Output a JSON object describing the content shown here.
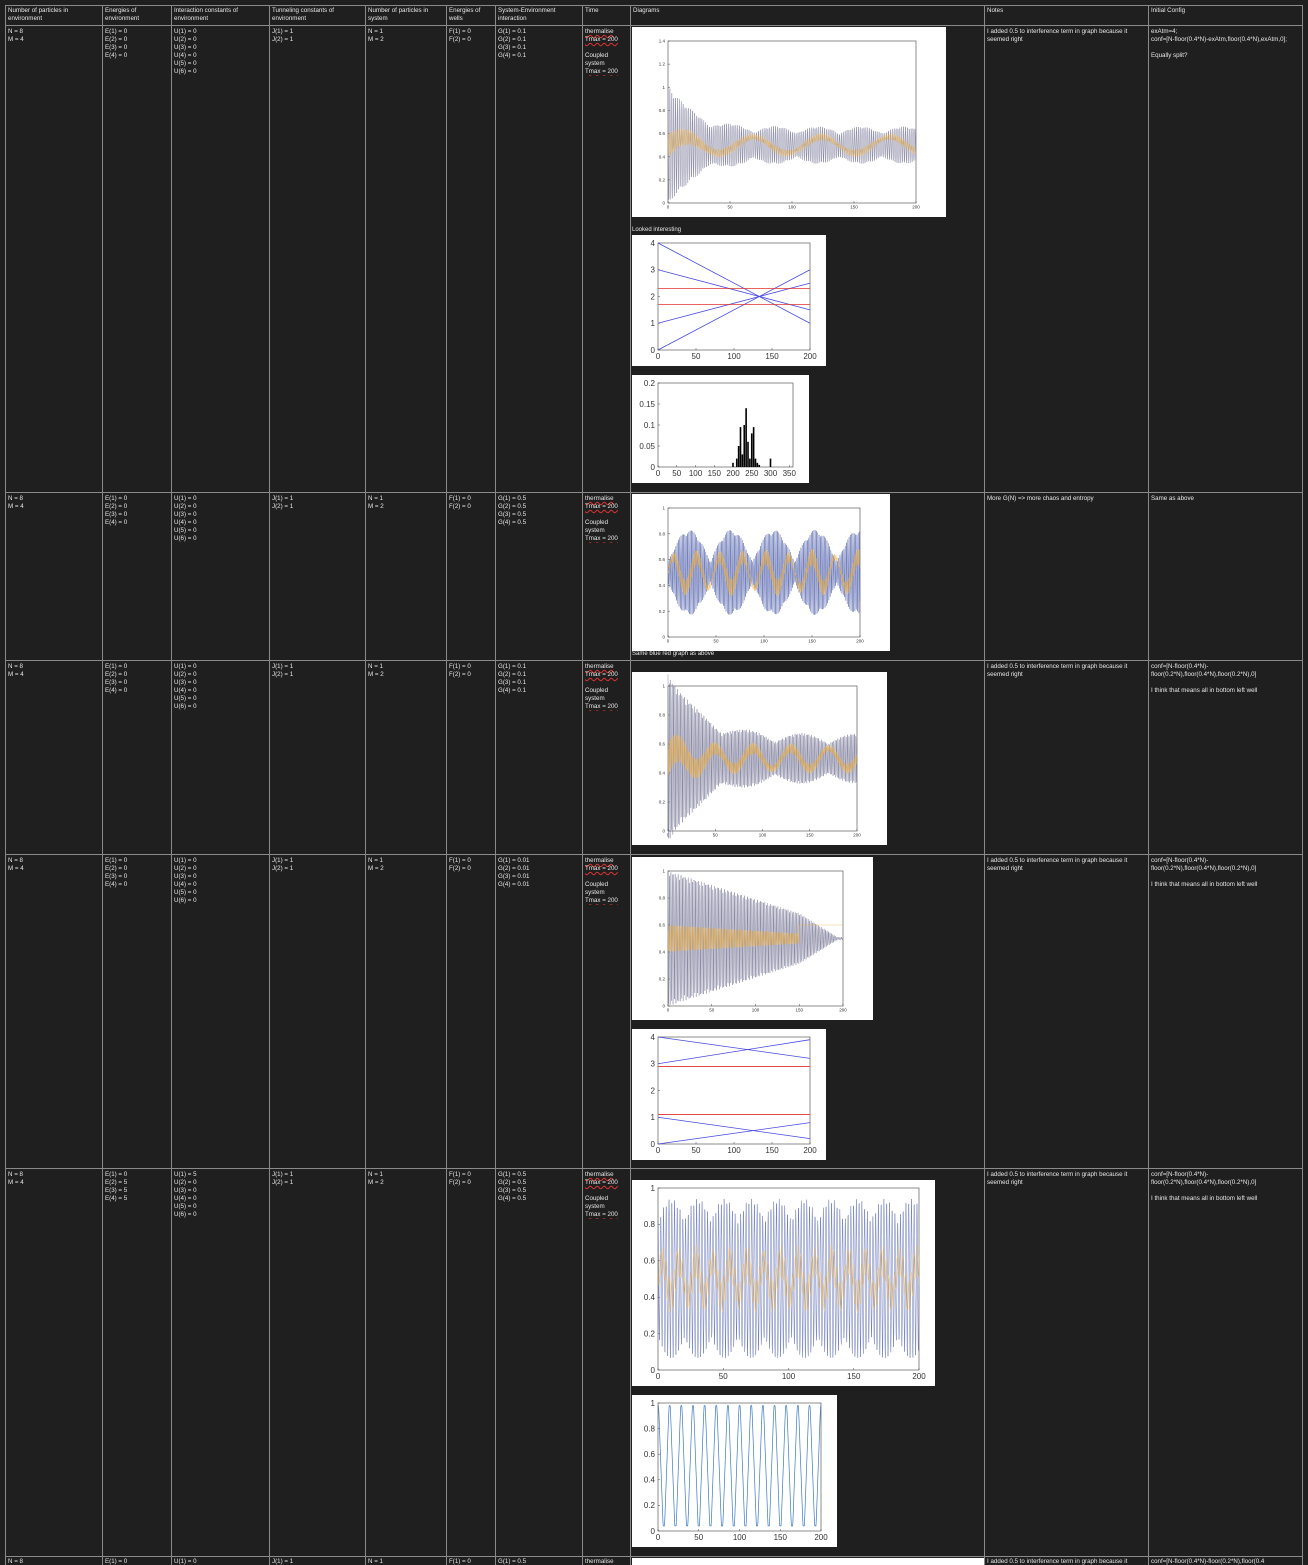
{
  "headers": [
    "Number of  particles in environment",
    "Energies of environment",
    "Interaction constants of environment",
    "Tunneling constants of environment",
    "Number of particles in system",
    "Energies of wells",
    "System-Environment interaction",
    "Time",
    "Diagrams",
    "Notes",
    "Initial Config"
  ],
  "rows": [
    {
      "n_env": "N = 8\nM = 4",
      "e_env": "E(1) = 0\nE(2) = 0\nE(3) = 0\nE(4) = 0",
      "u_env": "U(1) = 0\nU(2) = 0\nU(3) = 0\nU(4) = 0\nU(5) = 0\nU(6) = 0",
      "j_env": "J(1) = 1\nJ(2) = 1",
      "n_sys": "N = 1\nM = 2",
      "f_wells": "F(1) = 0\nF(2) = 0",
      "g_int": "G(1) = 0.1\nG(2) = 0.1\nG(3) = 0.1\nG(4) = 0.1",
      "time_a": "thermalise",
      "time_b": "Tmax = 200",
      "time_c": "Coupled\nsystem",
      "time_d": "Tmax = 200",
      "caption": "Looked interesting",
      "notes": "I added 0.5 to interference term in graph because it seemed right",
      "config": "exAtm=4;\nconf=[N-floor(0.4*N)-exAtm,floor(0.4*N),exAtm,0];\n\nEqually split?"
    },
    {
      "n_env": "N = 8\nM = 4",
      "e_env": "E(1) = 0\nE(2) = 0\nE(3) = 0\nE(4) = 0",
      "u_env": "U(1) = 0\nU(2) = 0\nU(3) = 0\nU(4) = 0\nU(5) = 0\nU(6) = 0",
      "j_env": "J(1) = 1\nJ(2) = 1",
      "n_sys": "N = 1\nM = 2",
      "f_wells": "F(1) = 0\nF(2) = 0",
      "g_int": "G(1) = 0.5\nG(2) = 0.5\nG(3) = 0.5\nG(4) = 0.5",
      "time_a": "thermalise",
      "time_b": "Tmax = 200",
      "time_c": "Coupled\nsystem",
      "time_d": "Tmax = 200",
      "caption": "Same blue red graph as above",
      "notes": "More G(N) => more chaos and entropy",
      "config": "Same as above"
    },
    {
      "n_env": "N = 8\nM = 4",
      "e_env": "E(1) = 0\nE(2) = 0\nE(3) = 0\nE(4) = 0",
      "u_env": "U(1) = 0\nU(2) = 0\nU(3) = 0\nU(4) = 0\nU(5) = 0\nU(6) = 0",
      "j_env": "J(1) = 1\nJ(2) = 1",
      "n_sys": "N = 1\nM = 2",
      "f_wells": "F(1) = 0\nF(2) = 0",
      "g_int": "G(1) = 0.1\nG(2) = 0.1\nG(3) = 0.1\nG(4) = 0.1",
      "time_a": "thermalise",
      "time_b": "Tmax = 200",
      "time_c": "Coupled\nsystem",
      "time_d": "Tmax = 200",
      "notes": "I added 0.5 to interference term in graph because it seemed right",
      "config": "conf=[N-floor(0.4*N)-floor(0.2*N),floor(0.4*N),floor(0.2*N),0]\n\nI think that means all in bottom left well"
    },
    {
      "n_env": "N = 8\nM = 4",
      "e_env": "E(1) = 0\nE(2) = 0\nE(3) = 0\nE(4) = 0",
      "u_env": "U(1) = 0\nU(2) = 0\nU(3) = 0\nU(4) = 0\nU(5) = 0\nU(6) = 0",
      "j_env": "J(1) = 1\nJ(2) = 1",
      "n_sys": "N = 1\nM = 2",
      "f_wells": "F(1) = 0\nF(2) = 0",
      "g_int": "G(1) = 0.01\nG(2) = 0.01\nG(3) = 0.01\nG(4) = 0.01",
      "time_a": "thermalise",
      "time_b": "Tmax = 200",
      "time_c": "Coupled\nsystem",
      "time_d": "Tmax = 200",
      "notes": "I added 0.5 to interference term in graph because it seemed right",
      "config": "conf=[N-floor(0.4*N)-floor(0.2*N),floor(0.4*N),floor(0.2*N),0]\n\nI think that means all in bottom left well"
    },
    {
      "n_env": "N = 8\nM = 4",
      "e_env": "E(1) = 0\nE(2) = 5\nE(3) = 5\nE(4) = 5",
      "u_env": "U(1) = 5\nU(2) = 0\nU(3) = 0\nU(4) = 0\nU(5) = 0\nU(6) = 0",
      "j_env": "J(1) = 1\nJ(2) = 1",
      "n_sys": "N = 1\nM = 2",
      "f_wells": "F(1) = 0\nF(2) = 0",
      "g_int": "G(1) = 0.5\nG(2) = 0.5\nG(3) = 0.5\nG(4) = 0.5",
      "time_a": "thermalise",
      "time_b": "Tmax = 200",
      "time_c": "Coupled\nsystem",
      "time_d": "Tmax = 200",
      "notes": "I added 0.5 to interference term in graph because it seemed right",
      "config": "conf=[N-floor(0.4*N)-floor(0.2*N),floor(0.4*N),floor(0.2*N),0]\n\nI think that means all in bottom left well"
    },
    {
      "n_env": "N = 8",
      "e_env": "E(1) = 0",
      "u_env": "U(1) = 0",
      "j_env": "J(1) = 1",
      "n_sys": "N = 1",
      "f_wells": "F(1) = 0",
      "g_int": "G(1) = 0.5",
      "time_a": "thermalise",
      "notes": "I added 0.5 to interference term in graph because it",
      "config": "conf=[N-floor(0.4*N)-floor(0.2*N),floor(0.4"
    }
  ],
  "chart_data": [
    {
      "id": "p1",
      "type": "line",
      "x_ticks": [
        0,
        50,
        100,
        150,
        200
      ],
      "y_ticks": [
        0,
        0.2,
        0.4,
        0.6,
        0.8,
        1,
        1.2,
        1.4
      ],
      "xlim": [
        0,
        200
      ],
      "ylim": [
        0,
        1.4
      ],
      "series": [
        {
          "color": "#7a7a9a"
        },
        {
          "color": "#f0b040"
        }
      ]
    },
    {
      "id": "p2",
      "type": "line",
      "x_ticks": [
        0,
        50,
        100,
        150,
        200
      ],
      "y_ticks": [
        0,
        1,
        2,
        3,
        4
      ],
      "xlim": [
        0,
        200
      ],
      "ylim": [
        0,
        4
      ],
      "series": [
        {
          "color": "#4a4ae0",
          "x": [
            0,
            200
          ],
          "y": [
            0,
            3.0
          ]
        },
        {
          "color": "#4a4ae0",
          "x": [
            0,
            200
          ],
          "y": [
            1,
            2.5
          ]
        },
        {
          "color": "#4a4ae0",
          "x": [
            0,
            200
          ],
          "y": [
            3,
            1.5
          ]
        },
        {
          "color": "#4a4ae0",
          "x": [
            0,
            200
          ],
          "y": [
            4,
            1.0
          ]
        },
        {
          "color": "#e03030",
          "x": [
            0,
            200
          ],
          "y": [
            2.3,
            2.3
          ]
        },
        {
          "color": "#e03030",
          "x": [
            0,
            200
          ],
          "y": [
            1.7,
            1.7
          ]
        }
      ]
    },
    {
      "id": "p3",
      "type": "bar",
      "x_ticks": [
        0,
        50,
        100,
        150,
        200,
        250,
        300,
        350
      ],
      "y_ticks": [
        0,
        0.05,
        0.1,
        0.15,
        0.2
      ],
      "xlim": [
        0,
        360
      ],
      "ylim": [
        0,
        0.2
      ],
      "x": [
        200,
        210,
        215,
        220,
        225,
        230,
        235,
        240,
        245,
        250,
        255,
        260,
        265,
        270,
        300
      ],
      "values": [
        0.01,
        0.02,
        0.05,
        0.095,
        0.03,
        0.1,
        0.14,
        0.06,
        0.02,
        0.08,
        0.095,
        0.02,
        0.01,
        0.005,
        0.02
      ]
    },
    {
      "id": "p4",
      "type": "line",
      "x_ticks": [
        0,
        50,
        100,
        150,
        200
      ],
      "y_ticks": [
        0,
        0.2,
        0.4,
        0.6,
        0.8,
        1
      ],
      "xlim": [
        0,
        200
      ],
      "ylim": [
        0,
        1
      ],
      "series": [
        {
          "color": "#5a6ab0"
        },
        {
          "color": "#f0b040"
        }
      ]
    },
    {
      "id": "p5",
      "type": "line",
      "x_ticks": [
        0,
        50,
        100,
        150,
        200
      ],
      "y_ticks": [
        0,
        0.2,
        0.4,
        0.6,
        0.8,
        1
      ],
      "xlim": [
        0,
        200
      ],
      "ylim": [
        0,
        1
      ],
      "series": [
        {
          "color": "#7a7a9a"
        },
        {
          "color": "#f0b040"
        }
      ]
    },
    {
      "id": "p6",
      "type": "line",
      "x_ticks": [
        0,
        50,
        100,
        150,
        200
      ],
      "y_ticks": [
        0,
        0.2,
        0.4,
        0.6,
        0.8,
        1
      ],
      "xlim": [
        0,
        200
      ],
      "ylim": [
        0,
        1
      ],
      "series": [
        {
          "color": "#7a7a9a"
        },
        {
          "color": "#f0b040"
        }
      ]
    },
    {
      "id": "p7",
      "type": "line",
      "x_ticks": [
        0,
        50,
        100,
        150,
        200
      ],
      "y_ticks": [
        0,
        1,
        2,
        3,
        4
      ],
      "xlim": [
        0,
        200
      ],
      "ylim": [
        0,
        4
      ],
      "series": [
        {
          "color": "#4a4ae0",
          "x": [
            0,
            200
          ],
          "y": [
            4,
            3.2
          ]
        },
        {
          "color": "#4a4ae0",
          "x": [
            0,
            200
          ],
          "y": [
            3.0,
            3.9
          ]
        },
        {
          "color": "#4a4ae0",
          "x": [
            0,
            200
          ],
          "y": [
            0,
            0.8
          ]
        },
        {
          "color": "#4a4ae0",
          "x": [
            0,
            200
          ],
          "y": [
            1.0,
            0.2
          ]
        },
        {
          "color": "#e03030",
          "x": [
            0,
            200
          ],
          "y": [
            2.9,
            2.9
          ]
        },
        {
          "color": "#e03030",
          "x": [
            0,
            200
          ],
          "y": [
            1.1,
            1.1
          ]
        }
      ]
    },
    {
      "id": "p8",
      "type": "line",
      "x_ticks": [
        0,
        50,
        100,
        150,
        200
      ],
      "y_ticks": [
        0,
        0.2,
        0.4,
        0.6,
        0.8,
        1
      ],
      "xlim": [
        0,
        200
      ],
      "ylim": [
        0,
        1
      ],
      "series": [
        {
          "color": "#5a6ab0"
        },
        {
          "color": "#f0b040"
        }
      ]
    },
    {
      "id": "p9",
      "type": "line",
      "x_ticks": [
        0,
        50,
        100,
        150,
        200
      ],
      "y_ticks": [
        0,
        0.2,
        0.4,
        0.6,
        0.8,
        1
      ],
      "xlim": [
        0,
        200
      ],
      "ylim": [
        0,
        1
      ],
      "series": [
        {
          "color": "#3a7ac0"
        }
      ]
    }
  ]
}
